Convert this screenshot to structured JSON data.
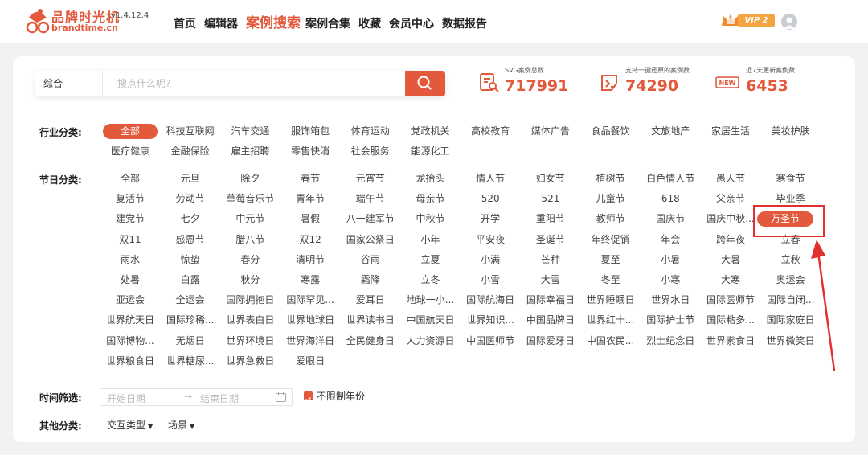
{
  "header": {
    "logo_name": "品牌时光机",
    "version": "v1.4.12.4",
    "domain": "brandtime.cn",
    "nav": [
      {
        "label": "首页",
        "active": false
      },
      {
        "label": "编辑器",
        "active": false
      },
      {
        "label": "案例搜索",
        "active": true
      },
      {
        "label": "案例合集",
        "active": false
      },
      {
        "label": "收藏",
        "active": false
      },
      {
        "label": "会员中心",
        "active": false
      },
      {
        "label": "数据报告",
        "active": false
      }
    ],
    "vip_label": "VIP 2"
  },
  "search": {
    "category": "综合",
    "placeholder": "搜点什么呢?"
  },
  "stats": [
    {
      "label": "SVG案例总数",
      "value": "717991",
      "icon": "document-search-icon"
    },
    {
      "label": "支持一键还原的案例数",
      "value": "74290",
      "icon": "restore-icon"
    },
    {
      "label": "近7天更新案例数",
      "value": "6453",
      "icon": "new-badge-icon"
    }
  ],
  "filters": {
    "industry": {
      "label": "行业分类:",
      "items": [
        "全部",
        "科技互联网",
        "汽车交通",
        "服饰箱包",
        "体育运动",
        "党政机关",
        "高校教育",
        "媒体广告",
        "食品餐饮",
        "文旅地产",
        "家居生活",
        "美妆护肤",
        "医疗健康",
        "金融保险",
        "雇主招聘",
        "零售快消",
        "社会服务",
        "能源化工"
      ],
      "selected": "全部"
    },
    "festival": {
      "label": "节日分类:",
      "items": [
        "全部",
        "元旦",
        "除夕",
        "春节",
        "元宵节",
        "龙抬头",
        "情人节",
        "妇女节",
        "植树节",
        "白色情人节",
        "愚人节",
        "寒食节",
        "复活节",
        "劳动节",
        "草莓音乐节",
        "青年节",
        "端午节",
        "母亲节",
        "520",
        "521",
        "儿童节",
        "618",
        "父亲节",
        "毕业季",
        "建党节",
        "七夕",
        "中元节",
        "暑假",
        "八一建军节",
        "中秋节",
        "开学",
        "重阳节",
        "教师节",
        "国庆节",
        "国庆中秋...",
        "万圣节",
        "双11",
        "感恩节",
        "腊八节",
        "双12",
        "国家公祭日",
        "小年",
        "平安夜",
        "圣诞节",
        "年终促销",
        "年会",
        "跨年夜",
        "立春",
        "雨水",
        "惊蛰",
        "春分",
        "清明节",
        "谷雨",
        "立夏",
        "小满",
        "芒种",
        "夏至",
        "小暑",
        "大暑",
        "立秋",
        "处暑",
        "白露",
        "秋分",
        "寒露",
        "霜降",
        "立冬",
        "小雪",
        "大雪",
        "冬至",
        "小寒",
        "大寒",
        "奥运会",
        "亚运会",
        "全运会",
        "国际拥抱日",
        "国际罕见...",
        "爱耳日",
        "地球一小...",
        "国际航海日",
        "国际幸福日",
        "世界睡眠日",
        "世界水日",
        "国际医师节",
        "国际自闭...",
        "世界航天日",
        "国际珍稀...",
        "世界表白日",
        "世界地球日",
        "世界读书日",
        "中国航天日",
        "世界知识...",
        "中国品牌日",
        "世界红十...",
        "国际护士节",
        "国际粘多...",
        "国际家庭日",
        "国际博物...",
        "无烟日",
        "世界环境日",
        "世界海洋日",
        "全民健身日",
        "人力资源日",
        "中国医师节",
        "国际爱牙日",
        "中国农民...",
        "烈士纪念日",
        "世界素食日",
        "世界微笑日",
        "世界粮食日",
        "世界糖尿...",
        "世界急救日",
        "爱眼日"
      ],
      "selected": "万圣节"
    },
    "time": {
      "label": "时间筛选:",
      "start_placeholder": "开始日期",
      "arrow": "→",
      "end_placeholder": "结束日期",
      "checkbox_label": "不限制年份",
      "checkbox_checked": true
    },
    "other": {
      "label": "其他分类:",
      "dropdowns": [
        "交互类型",
        "场景"
      ]
    }
  },
  "colors": {
    "accent": "#e2593c",
    "highlight_box": "#e1302f"
  }
}
